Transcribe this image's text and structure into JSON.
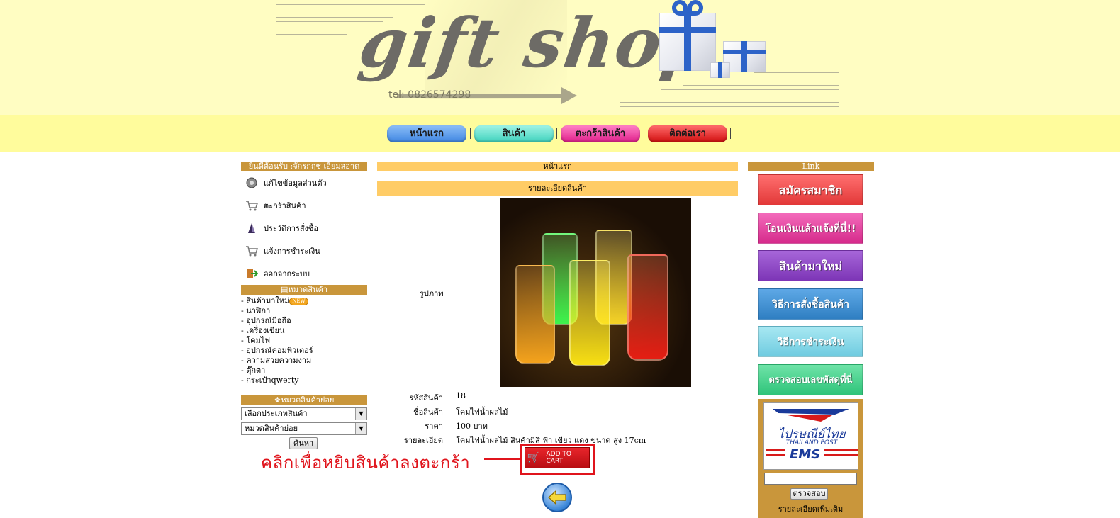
{
  "banner": {
    "logo": "gift shop",
    "tel": "tel: 0826574298"
  },
  "nav": {
    "items": [
      "หน้าแรก",
      "สินค้า",
      "ตะกร้าสินค้า",
      "ติดต่อเรา"
    ],
    "separator": "|"
  },
  "left": {
    "welcome": "ยินดีต้อนรับ :จักรกฤช เอี่ยมสอาด",
    "menu": [
      {
        "label": "แก้ไขข้อมูลส่วนตัว",
        "icon": "gear-icon"
      },
      {
        "label": "ตะกร้าสินค้า",
        "icon": "cart-icon"
      },
      {
        "label": "ประวัติการสั่งซื้อ",
        "icon": "history-icon"
      },
      {
        "label": "แจ้งการชำระเงิน",
        "icon": "payment-icon"
      },
      {
        "label": "ออกจากระบบ",
        "icon": "logout-icon"
      }
    ],
    "category_header": "หมวดสินค้า",
    "categories": [
      "- สินค้ามาใหม่",
      "- นาฬิกา",
      "- อุปกรณ์มือถือ",
      "- เครื่องเขียน",
      "- โคมไฟ",
      "- อุปกรณ์คอมพิวเตอร์",
      "- ความสวยความงาม",
      "- ตุ๊กตา",
      "- กระเป๋าqwerty"
    ],
    "new_badge": "NEW",
    "subcategory_header": "หมวดสินค้าย่อย",
    "select_type": "เลือกประเภทสินค้า",
    "select_sub": "หมวดสินค้าย่อย",
    "search_button": "ค้นหา"
  },
  "center": {
    "breadcrumb": "หน้าแรก",
    "section_title": "รายละเอียดสินค้า",
    "image_label": "รูปภาพ",
    "fields": [
      {
        "label": "รหัสสินค้า",
        "value": "18"
      },
      {
        "label": "ชื่อสินค้า",
        "value": "โคมไฟน้ำผลไม้"
      },
      {
        "label": "ราคา",
        "value": "100 บาท"
      },
      {
        "label": "รายละเอียด",
        "value": "โคมไฟน้ำผลไม้ สินค้ามีสี ฟ้า เขียว แดง ขนาด สูง 17cm"
      }
    ],
    "callout": "คลิกเพื่อหยิบสินค้าลงตะกร้า",
    "add_to_cart": "ADD TO CART"
  },
  "right": {
    "header": "Link",
    "links": [
      {
        "label": "สมัครสมาชิก",
        "color": "#ef4a4a"
      },
      {
        "label": "โอนเงินแล้วแจ้งที่นี่!!",
        "color": "#e03c9b"
      },
      {
        "label": "สินค้ามาใหม่",
        "color": "#8e44c4"
      },
      {
        "label": "วิธีการสั่งซื้อสินค้า",
        "color": "#3b8ecf"
      },
      {
        "label": "วิธีการชำระเงิน",
        "color": "#7fd6e6"
      },
      {
        "label": "ตรวจสอบเลขพัสดุที่นี่",
        "color": "#3fcf8a"
      }
    ],
    "post_logo_thai": "ไปรษณีย์ไทย",
    "post_logo_en": "THAILAND POST",
    "ems": "EMS",
    "check_button": "ตรวจสอบ",
    "more": "รายละเอียดเพิ่มเติม"
  }
}
